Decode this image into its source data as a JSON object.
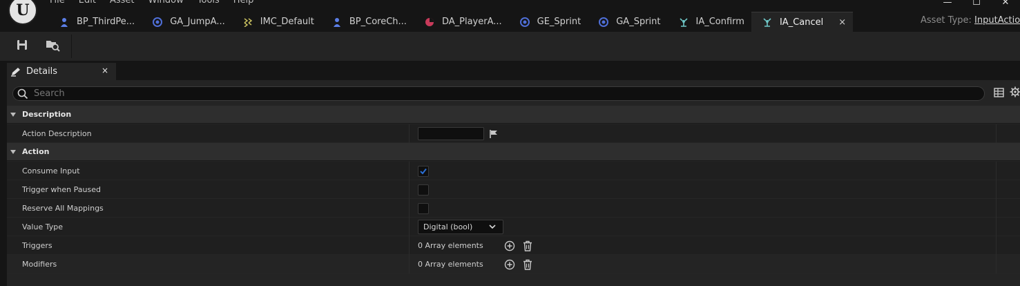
{
  "app": {
    "logo_text": "U"
  },
  "menu": [
    "File",
    "Edit",
    "Asset",
    "Window",
    "Tools",
    "Help"
  ],
  "window_controls": {
    "minimize": "—",
    "maximize": "☐",
    "close": "✕"
  },
  "tabs": [
    {
      "label": "BP_ThirdPe...",
      "icon": "character-icon",
      "icon_color": "#5b7ee6"
    },
    {
      "label": "GA_JumpA...",
      "icon": "gameplay-ability-icon",
      "icon_color": "#4f6fd8"
    },
    {
      "label": "IMC_Default",
      "icon": "input-mapping-icon",
      "icon_color": "#c8c060"
    },
    {
      "label": "BP_CoreCh...",
      "icon": "character-icon",
      "icon_color": "#5b7ee6"
    },
    {
      "label": "DA_PlayerA...",
      "icon": "data-asset-icon",
      "icon_color": "#c83a5a"
    },
    {
      "label": "GE_Sprint",
      "icon": "gameplay-effect-icon",
      "icon_color": "#4f6fd8"
    },
    {
      "label": "GA_Sprint",
      "icon": "gameplay-ability-icon",
      "icon_color": "#4f6fd8"
    },
    {
      "label": "IA_Confirm",
      "icon": "input-action-icon",
      "icon_color": "#6fc8c8"
    },
    {
      "label": "IA_Cancel",
      "icon": "input-action-icon",
      "icon_color": "#6fc8c8",
      "active": true,
      "close": "×"
    }
  ],
  "asset_type": {
    "label": "Asset Type:",
    "value": "InputAction"
  },
  "toolbar": {
    "save": "save-icon",
    "browse": "browse-to-asset-icon"
  },
  "details": {
    "tab_label": "Details",
    "tab_close": "×",
    "search_placeholder": "Search",
    "categories": [
      {
        "name": "Description",
        "rows": [
          {
            "label": "Action Description",
            "kind": "text",
            "value": ""
          }
        ]
      },
      {
        "name": "Action",
        "rows": [
          {
            "label": "Consume Input",
            "kind": "checkbox",
            "checked": true
          },
          {
            "label": "Trigger when Paused",
            "kind": "checkbox",
            "checked": false
          },
          {
            "label": "Reserve All Mappings",
            "kind": "checkbox",
            "checked": false
          },
          {
            "label": "Value Type",
            "kind": "dropdown",
            "value": "Digital (bool)"
          },
          {
            "label": "Triggers",
            "kind": "array",
            "value": "0 Array elements"
          },
          {
            "label": "Modifiers",
            "kind": "array",
            "value": "0 Array elements"
          }
        ]
      }
    ]
  },
  "colors": {
    "accent": "#2a6fd6",
    "background": "#151515",
    "panel": "#242424"
  }
}
